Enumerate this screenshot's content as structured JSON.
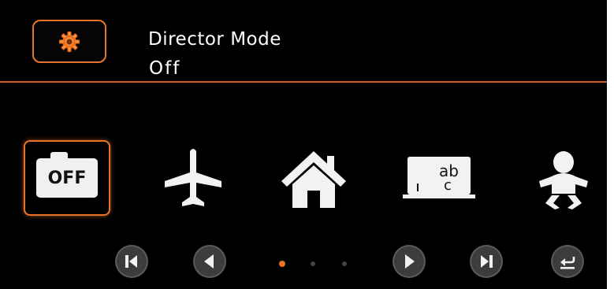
{
  "header": {
    "title": "Director Mode",
    "value": "Off",
    "settings_icon": "gear-icon",
    "accent_color": "#e8742a"
  },
  "modes": {
    "items": [
      {
        "id": "off",
        "label": "OFF",
        "icon": "camera-off-icon",
        "selected": true
      },
      {
        "id": "airplane",
        "icon": "airplane-icon",
        "selected": false
      },
      {
        "id": "home",
        "icon": "home-icon",
        "selected": false
      },
      {
        "id": "classroom",
        "board_text_top": "ab",
        "board_text_bottom": "c",
        "icon": "chalkboard-icon",
        "selected": false
      },
      {
        "id": "baby",
        "icon": "baby-icon",
        "selected": false
      }
    ]
  },
  "pagination": {
    "current_page": 1,
    "total_pages": 3,
    "active_color": "#e8742a",
    "inactive_color": "#444444"
  },
  "navigation": {
    "buttons": [
      "skip-previous-icon",
      "previous-icon",
      "next-icon",
      "skip-next-icon",
      "return-icon"
    ]
  }
}
